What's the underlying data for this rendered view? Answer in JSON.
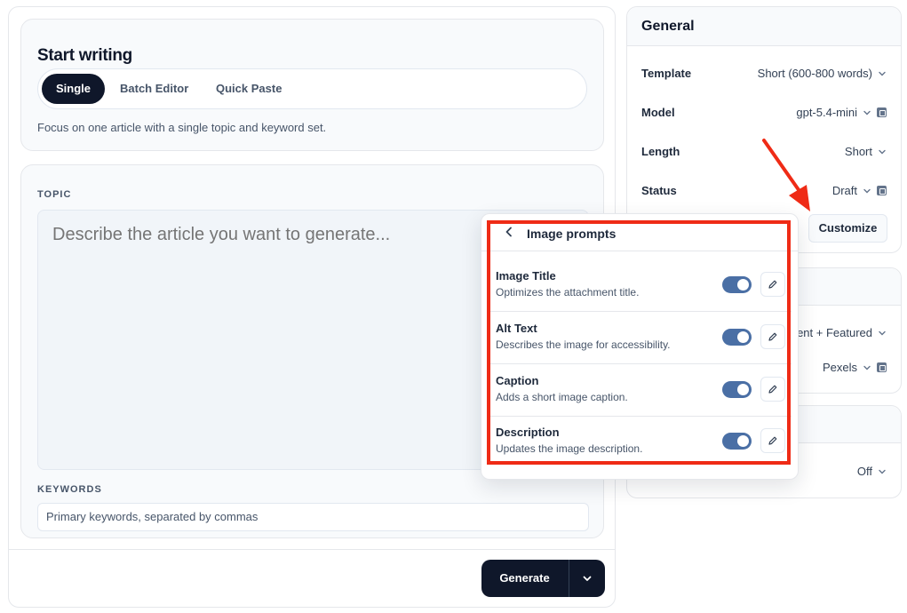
{
  "start": {
    "title": "Start writing",
    "tabs": [
      {
        "label": "Single",
        "active": true
      },
      {
        "label": "Batch Editor",
        "active": false
      },
      {
        "label": "Quick Paste",
        "active": false
      }
    ],
    "description": "Focus on one article with a single topic and keyword set."
  },
  "topic": {
    "label": "TOPIC",
    "placeholder": "Describe the article you want to generate...",
    "value": ""
  },
  "keywords": {
    "label": "KEYWORDS",
    "placeholder": "Primary keywords, separated by commas",
    "value": ""
  },
  "generate": {
    "label": "Generate",
    "caret_icon": "chevron-down-icon"
  },
  "general": {
    "title": "General",
    "settings": [
      {
        "label": "Template",
        "value": "Short (600-800 words)",
        "control": "chevron-down-icon"
      },
      {
        "label": "Model",
        "value": "gpt-5.4-mini",
        "control": "chevron-down-icon",
        "extra_icon": "settings-icon"
      },
      {
        "label": "Length",
        "value": "Short",
        "control": "chevron-down-icon"
      },
      {
        "label": "Status",
        "value": "Draft",
        "control": "chevron-down-icon",
        "extra_icon": "settings-icon"
      }
    ],
    "customize_label": "Customize"
  },
  "images_panel": {
    "settings": [
      {
        "value": "ent + Featured",
        "control": "chevron-down-icon"
      },
      {
        "value": "Pexels",
        "control": "chevron-down-icon",
        "extra_icon": "settings-icon"
      }
    ]
  },
  "third_panel": {
    "settings": [
      {
        "value": "Off",
        "control": "chevron-down-icon"
      }
    ]
  },
  "popup": {
    "title": "Image prompts",
    "back_icon": "chevron-left-icon",
    "rows": [
      {
        "title": "Image Title",
        "description": "Optimizes the attachment title.",
        "enabled": true,
        "edit_icon": "pencil-icon"
      },
      {
        "title": "Alt Text",
        "description": "Describes the image for accessibility.",
        "enabled": true,
        "edit_icon": "pencil-icon"
      },
      {
        "title": "Caption",
        "description": "Adds a short image caption.",
        "enabled": true,
        "edit_icon": "pencil-icon"
      },
      {
        "title": "Description",
        "description": "Updates the image description.",
        "enabled": true,
        "edit_icon": "pencil-icon"
      }
    ]
  },
  "annotation": {
    "highlight_color": "#ef2b16",
    "arrow_color": "#ef2b16"
  },
  "colors": {
    "primary": "#0f172a",
    "toggle_on": "#4a6fa5"
  }
}
